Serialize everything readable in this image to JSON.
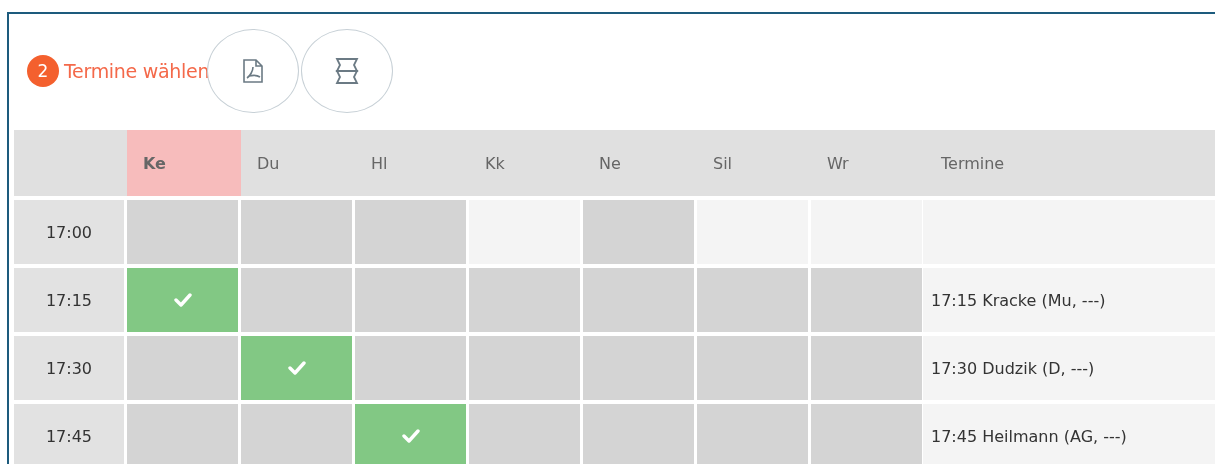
{
  "step": {
    "number": "2",
    "label": "Termine wählen"
  },
  "toolbar": [
    {
      "kind": "pdf"
    },
    {
      "kind": "layout"
    }
  ],
  "columns": [
    {
      "label": "Ke",
      "selected": true
    },
    {
      "label": "Du",
      "selected": false
    },
    {
      "label": "Hl",
      "selected": false
    },
    {
      "label": "Kk",
      "selected": false
    },
    {
      "label": "Ne",
      "selected": false
    },
    {
      "label": "Sil",
      "selected": false
    },
    {
      "label": "Wr",
      "selected": false
    }
  ],
  "appointments_header": "Termine",
  "rows": [
    {
      "time": "17:00",
      "slots": [
        {
          "kind": "busy"
        },
        {
          "kind": "busy"
        },
        {
          "kind": "busy"
        },
        {
          "kind": "free"
        },
        {
          "kind": "busy"
        },
        {
          "kind": "free"
        },
        {
          "kind": "free"
        }
      ]
    },
    {
      "time": "17:15",
      "slots": [
        {
          "kind": "booked"
        },
        {
          "kind": "busy"
        },
        {
          "kind": "busy"
        },
        {
          "kind": "busy"
        },
        {
          "kind": "busy"
        },
        {
          "kind": "busy"
        },
        {
          "kind": "busy"
        }
      ],
      "appointment": "17:15 Kracke (Mu, ---)"
    },
    {
      "time": "17:30",
      "slots": [
        {
          "kind": "busy"
        },
        {
          "kind": "booked"
        },
        {
          "kind": "busy"
        },
        {
          "kind": "busy"
        },
        {
          "kind": "busy"
        },
        {
          "kind": "busy"
        },
        {
          "kind": "busy"
        }
      ],
      "appointment": "17:30 Dudzik (D, ---)"
    },
    {
      "time": "17:45",
      "slots": [
        {
          "kind": "busy"
        },
        {
          "kind": "busy"
        },
        {
          "kind": "booked"
        },
        {
          "kind": "busy"
        },
        {
          "kind": "busy"
        },
        {
          "kind": "busy"
        },
        {
          "kind": "busy"
        }
      ],
      "appointment": "17:45 Heilmann (AG, ---)"
    }
  ]
}
